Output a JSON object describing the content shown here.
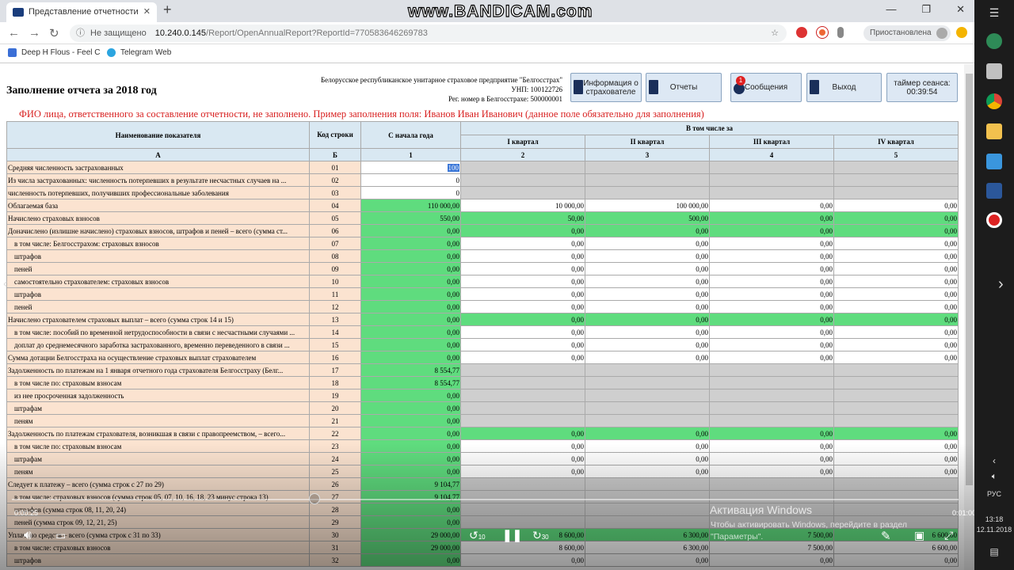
{
  "browser": {
    "tab_title": "Представление отчетности",
    "tab_close": "✕",
    "new_tab": "+",
    "win_min": "—",
    "win_max": "❐",
    "win_close": "✕",
    "not_secure": "Не защищено",
    "url_host": "10.240.0.145",
    "url_path": "/Report/OpenAnnualReport?ReportId=770583646269783",
    "paused": "Приостановлена",
    "bookmarks": [
      "Deep H Flous - Feel C",
      "Telegram Web"
    ]
  },
  "watermark": "www.BANDICAM.com",
  "header": {
    "title": "Заполнение отчета за 2018 год",
    "org_lines": [
      "Белорусское республиканское унитарное страховое предприятие \"Белгосстрах\"",
      "УНП: 100122726",
      "Рег. номер в Белгосстрахе: 500000001"
    ],
    "buttons": {
      "info": "Информация о страхователе",
      "reports": "Отчеты",
      "messages": "Сообщения",
      "exit": "Выход"
    },
    "messages_badge": "1",
    "timer_label": "таймер сеанса:",
    "timer_value": "00:39:54"
  },
  "warning": "ФИО лица, ответственного за составление отчетности, не заполнено. Пример заполнения поля: Иванов Иван Иванович (данное поле обязательно для заполнения)",
  "table": {
    "h_name": "Наименование показателя",
    "h_code": "Код строки",
    "h_ytd": "С начала года",
    "h_incl": "В том числе за",
    "quarters": [
      "I квартал",
      "II квартал",
      "III квартал",
      "IV квартал"
    ],
    "letters": [
      "А",
      "Б",
      "1",
      "2",
      "3",
      "4",
      "5"
    ],
    "rows": [
      {
        "name": "Средняя численность застрахованных",
        "code": "01",
        "v": [
          "100",
          "",
          "",
          "",
          ""
        ],
        "bg": [
          "w",
          "gr",
          "gr",
          "gr",
          "gr"
        ]
      },
      {
        "name": "Из числа застрахованных: численность потерпевших в результате несчастных случаев на ...",
        "code": "02",
        "v": [
          "0",
          "",
          "",
          "",
          ""
        ],
        "bg": [
          "w",
          "gr",
          "gr",
          "gr",
          "gr"
        ]
      },
      {
        "name": "численность потерпевших, получивших профессиональные заболевания",
        "code": "03",
        "v": [
          "0",
          "",
          "",
          "",
          ""
        ],
        "bg": [
          "w",
          "gr",
          "gr",
          "gr",
          "gr"
        ]
      },
      {
        "name": "Облагаемая база",
        "code": "04",
        "v": [
          "110 000,00",
          "10 000,00",
          "100 000,00",
          "0,00",
          "0,00"
        ],
        "bg": [
          "g",
          "w",
          "w",
          "w",
          "w"
        ]
      },
      {
        "name": "Начислено страховых взносов",
        "code": "05",
        "v": [
          "550,00",
          "50,00",
          "500,00",
          "0,00",
          "0,00"
        ],
        "bg": [
          "g",
          "g",
          "g",
          "g",
          "g"
        ]
      },
      {
        "name": "Доначислено (излишне начислено) страховых взносов, штрафов и пеней – всего (сумма ст...",
        "code": "06",
        "v": [
          "0,00",
          "0,00",
          "0,00",
          "0,00",
          "0,00"
        ],
        "bg": [
          "g",
          "g",
          "g",
          "g",
          "g"
        ]
      },
      {
        "name": "в том числе: Белгосстрахом: страховых взносов",
        "code": "07",
        "ind": 1,
        "v": [
          "0,00",
          "0,00",
          "0,00",
          "0,00",
          "0,00"
        ],
        "bg": [
          "g",
          "w",
          "w",
          "w",
          "w"
        ]
      },
      {
        "name": "штрафов",
        "code": "08",
        "ind": 1,
        "v": [
          "0,00",
          "0,00",
          "0,00",
          "0,00",
          "0,00"
        ],
        "bg": [
          "g",
          "w",
          "w",
          "w",
          "w"
        ]
      },
      {
        "name": "пеней",
        "code": "09",
        "ind": 1,
        "v": [
          "0,00",
          "0,00",
          "0,00",
          "0,00",
          "0,00"
        ],
        "bg": [
          "g",
          "w",
          "w",
          "w",
          "w"
        ]
      },
      {
        "name": "самостоятельно страхователем: страховых взносов",
        "code": "10",
        "ind": 1,
        "v": [
          "0,00",
          "0,00",
          "0,00",
          "0,00",
          "0,00"
        ],
        "bg": [
          "g",
          "w",
          "w",
          "w",
          "w"
        ]
      },
      {
        "name": "штрафов",
        "code": "11",
        "ind": 1,
        "v": [
          "0,00",
          "0,00",
          "0,00",
          "0,00",
          "0,00"
        ],
        "bg": [
          "g",
          "w",
          "w",
          "w",
          "w"
        ]
      },
      {
        "name": "пеней",
        "code": "12",
        "ind": 1,
        "v": [
          "0,00",
          "0,00",
          "0,00",
          "0,00",
          "0,00"
        ],
        "bg": [
          "g",
          "w",
          "w",
          "w",
          "w"
        ]
      },
      {
        "name": "Начислено страхователем страховых выплат – всего (сумма строк 14 и 15)",
        "code": "13",
        "v": [
          "0,00",
          "0,00",
          "0,00",
          "0,00",
          "0,00"
        ],
        "bg": [
          "g",
          "g",
          "g",
          "g",
          "g"
        ]
      },
      {
        "name": "в том числе: пособий по временной нетрудоспособности в связи с несчастными случаями ...",
        "code": "14",
        "ind": 1,
        "v": [
          "0,00",
          "0,00",
          "0,00",
          "0,00",
          "0,00"
        ],
        "bg": [
          "g",
          "w",
          "w",
          "w",
          "w"
        ]
      },
      {
        "name": "доплат до среднемесячного заработка застрахованного, временно переведенного в связи ...",
        "code": "15",
        "ind": 1,
        "v": [
          "0,00",
          "0,00",
          "0,00",
          "0,00",
          "0,00"
        ],
        "bg": [
          "g",
          "w",
          "w",
          "w",
          "w"
        ]
      },
      {
        "name": "Сумма дотации Белгосстраха на осуществление страховых выплат страхователем",
        "code": "16",
        "v": [
          "0,00",
          "0,00",
          "0,00",
          "0,00",
          "0,00"
        ],
        "bg": [
          "g",
          "w",
          "w",
          "w",
          "w"
        ]
      },
      {
        "name": "Задолженность по платежам на 1 января отчетного года страхователя Белгосстраху (Белг...",
        "code": "17",
        "v": [
          "8 554,77",
          "",
          "",
          "",
          ""
        ],
        "bg": [
          "g",
          "gr",
          "gr",
          "gr",
          "gr"
        ]
      },
      {
        "name": "в том числе по: страховым взносам",
        "code": "18",
        "ind": 1,
        "v": [
          "8 554,77",
          "",
          "",
          "",
          ""
        ],
        "bg": [
          "g",
          "gr",
          "gr",
          "gr",
          "gr"
        ]
      },
      {
        "name": "из нее просроченная задолженность",
        "code": "19",
        "ind": 1,
        "v": [
          "0,00",
          "",
          "",
          "",
          ""
        ],
        "bg": [
          "g",
          "gr",
          "gr",
          "gr",
          "gr"
        ]
      },
      {
        "name": "штрафам",
        "code": "20",
        "ind": 1,
        "v": [
          "0,00",
          "",
          "",
          "",
          ""
        ],
        "bg": [
          "g",
          "gr",
          "gr",
          "gr",
          "gr"
        ]
      },
      {
        "name": "пеням",
        "code": "21",
        "ind": 1,
        "v": [
          "0,00",
          "",
          "",
          "",
          ""
        ],
        "bg": [
          "g",
          "gr",
          "gr",
          "gr",
          "gr"
        ]
      },
      {
        "name": "Задолженность по платежам страхователя, возникшая в связи с правопреемством, – всего...",
        "code": "22",
        "v": [
          "0,00",
          "0,00",
          "0,00",
          "0,00",
          "0,00"
        ],
        "bg": [
          "g",
          "g",
          "g",
          "g",
          "g"
        ]
      },
      {
        "name": "в том числе по: страховым взносам",
        "code": "23",
        "ind": 1,
        "v": [
          "0,00",
          "0,00",
          "0,00",
          "0,00",
          "0,00"
        ],
        "bg": [
          "g",
          "w",
          "w",
          "w",
          "w"
        ]
      },
      {
        "name": "штрафам",
        "code": "24",
        "ind": 1,
        "v": [
          "0,00",
          "0,00",
          "0,00",
          "0,00",
          "0,00"
        ],
        "bg": [
          "g",
          "w",
          "w",
          "w",
          "w"
        ]
      },
      {
        "name": "пеням",
        "code": "25",
        "ind": 1,
        "v": [
          "0,00",
          "0,00",
          "0,00",
          "0,00",
          "0,00"
        ],
        "bg": [
          "g",
          "w",
          "w",
          "w",
          "w"
        ]
      },
      {
        "name": "Следует к платежу – всего (сумма строк с 27 по 29)",
        "code": "26",
        "v": [
          "9 104,77",
          "",
          "",
          "",
          ""
        ],
        "bg": [
          "g",
          "gr",
          "gr",
          "gr",
          "gr"
        ]
      },
      {
        "name": "в том числе: страховых взносов (сумма строк 05, 07, 10, 16, 18, 23 минус строка 13)",
        "code": "27",
        "ind": 1,
        "v": [
          "9 104,77",
          "",
          "",
          "",
          ""
        ],
        "bg": [
          "g",
          "gr",
          "gr",
          "gr",
          "gr"
        ]
      },
      {
        "name": "штрафов (сумма строк 08, 11, 20, 24)",
        "code": "28",
        "ind": 1,
        "v": [
          "0,00",
          "",
          "",
          "",
          ""
        ],
        "bg": [
          "g",
          "gr",
          "gr",
          "gr",
          "gr"
        ]
      },
      {
        "name": "пеней (сумма строк 09, 12, 21, 25)",
        "code": "29",
        "ind": 1,
        "v": [
          "0,00",
          "",
          "",
          "",
          ""
        ],
        "bg": [
          "g",
          "gr",
          "gr",
          "gr",
          "gr"
        ]
      },
      {
        "name": "Уплачено средств – всего (сумма строк с 31 по 33)",
        "code": "30",
        "v": [
          "29 000,00",
          "8 600,00",
          "6 300,00",
          "7 500,00",
          "6 600,00"
        ],
        "bg": [
          "g",
          "g",
          "g",
          "g",
          "g"
        ]
      },
      {
        "name": "в том числе: страховых взносов",
        "code": "31",
        "ind": 1,
        "v": [
          "29 000,00",
          "8 600,00",
          "6 300,00",
          "7 500,00",
          "6 600,00"
        ],
        "bg": [
          "g",
          "w",
          "w",
          "w",
          "w"
        ]
      },
      {
        "name": "штрафов",
        "code": "32",
        "ind": 1,
        "v": [
          "0,00",
          "0,00",
          "0,00",
          "0,00",
          "0,00"
        ],
        "bg": [
          "g",
          "w",
          "w",
          "w",
          "w"
        ]
      }
    ]
  },
  "player": {
    "elapsed": "0:00:25",
    "total": "0:01:00",
    "back": "10",
    "fwd": "30"
  },
  "activation": {
    "title": "Активация Windows",
    "text": "Чтобы активировать Windows, перейдите в раздел \"Параметры\"."
  },
  "taskbar": {
    "lang": "РУС",
    "time": "13:18",
    "date": "12.11.2018"
  },
  "colors": {
    "green": "#5fdc7e",
    "peach": "#fbe3d0",
    "header_blue": "#d9e8f2",
    "gray": "#cfcfcf",
    "warning_red": "#d82020"
  }
}
